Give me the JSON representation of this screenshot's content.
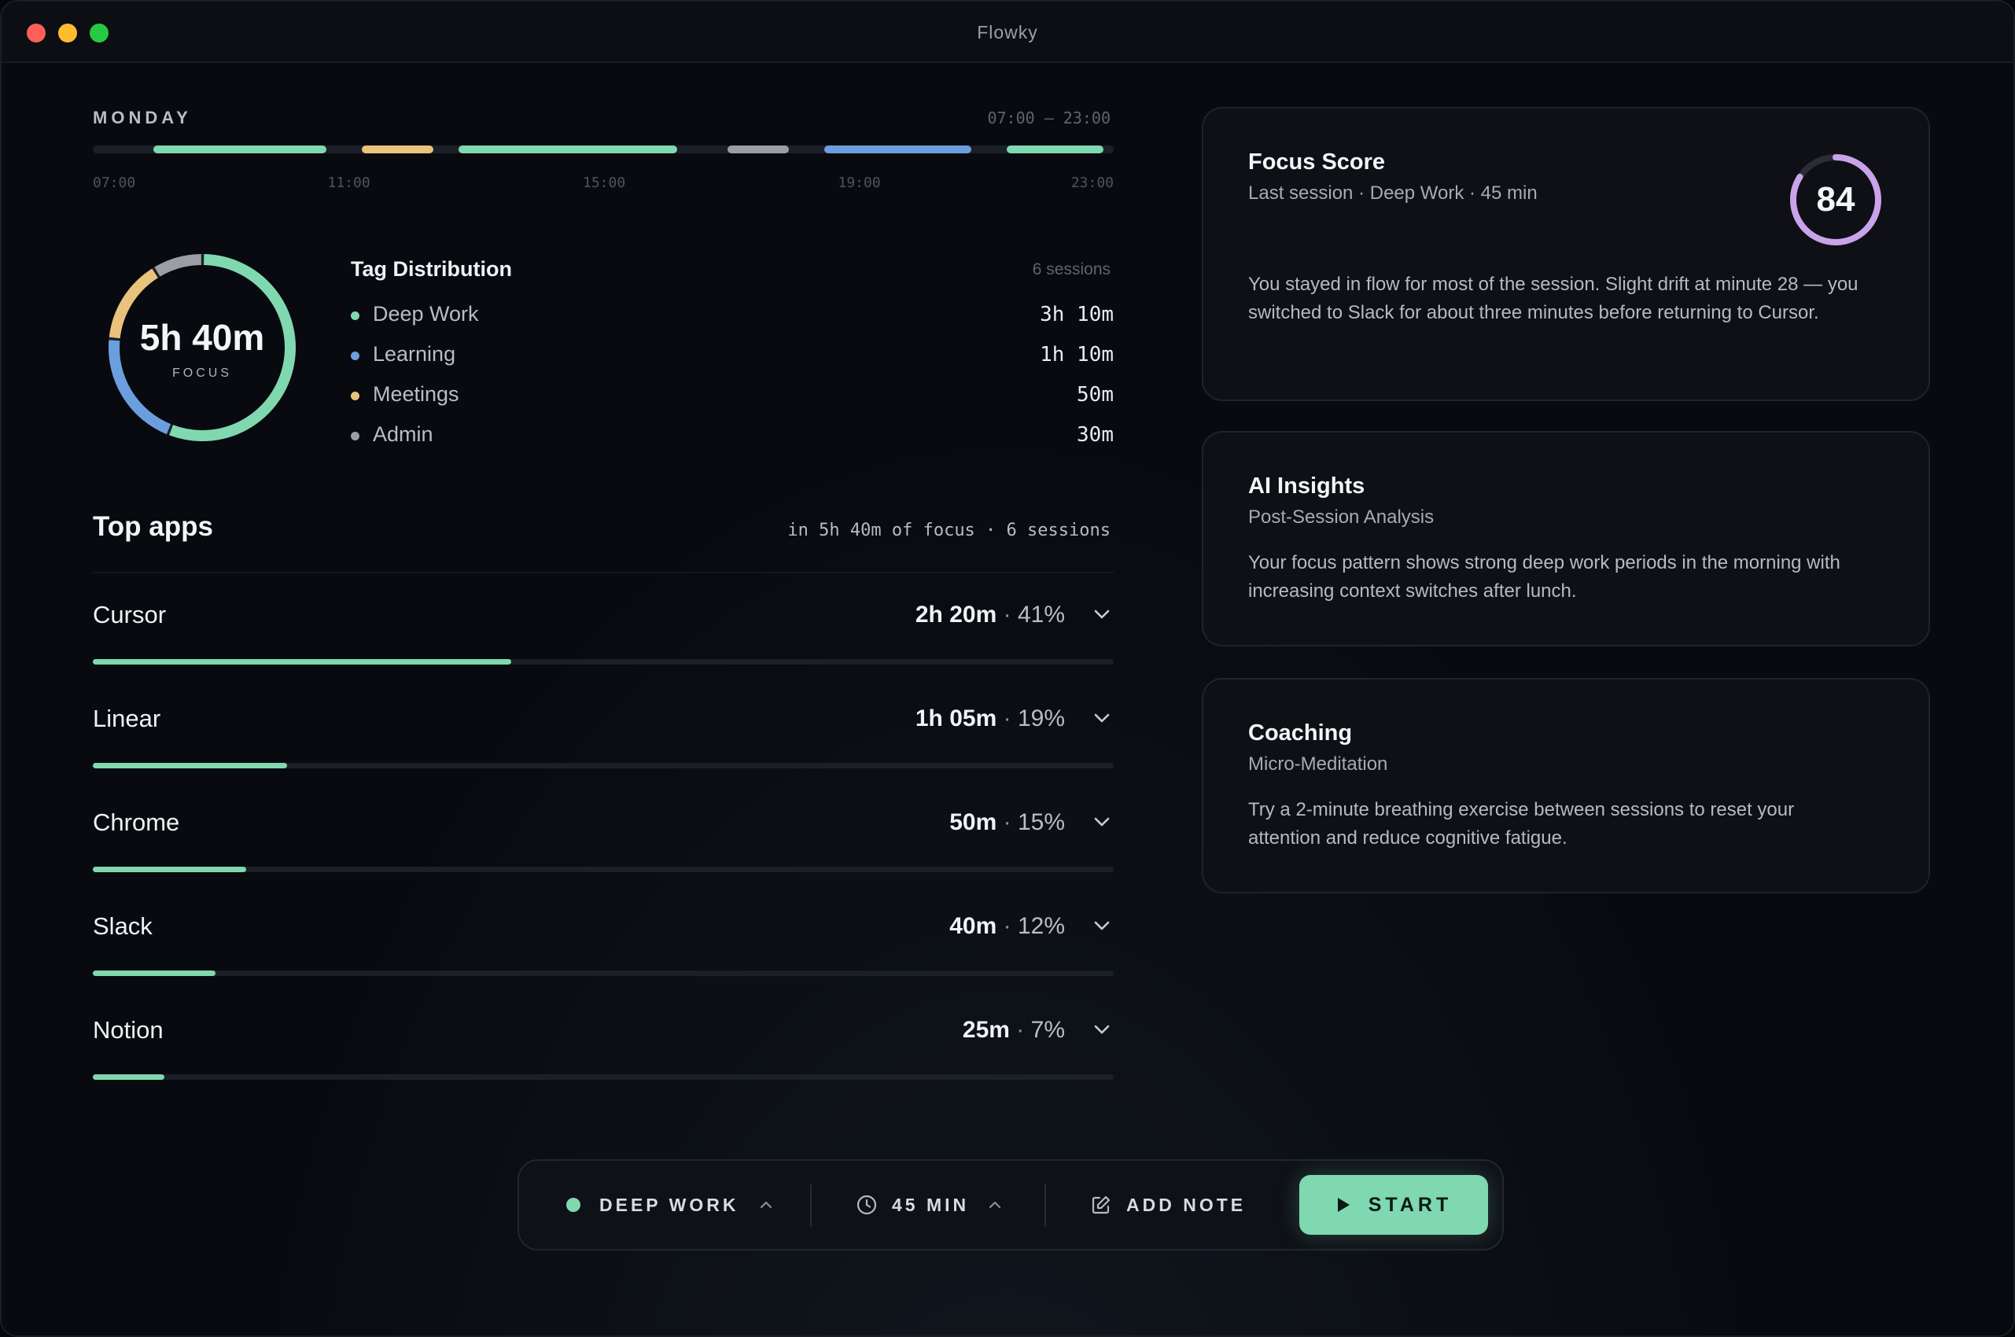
{
  "window": {
    "title": "Flowky"
  },
  "timeline": {
    "day": "MONDAY",
    "range": "07:00 — 23:00",
    "ticks": [
      "07:00",
      "11:00",
      "15:00",
      "19:00",
      "23:00"
    ],
    "segments": [
      {
        "start": "08:00",
        "end": "10:50",
        "color": "#7fd8b0"
      },
      {
        "start": "11:25",
        "end": "12:35",
        "color": "#e9c27c"
      },
      {
        "start": "13:00",
        "end": "16:35",
        "color": "#7fd8b0"
      },
      {
        "start": "17:25",
        "end": "18:25",
        "color": "#9a9ea5"
      },
      {
        "start": "19:00",
        "end": "21:25",
        "color": "#6b9ede"
      },
      {
        "start": "22:00",
        "end": "23:35",
        "color": "#7fd8b0"
      }
    ]
  },
  "focus_total": {
    "value": "5h 40m",
    "label": "FOCUS"
  },
  "tags": {
    "title": "Tag Distribution",
    "sessions": "6 sessions",
    "items": [
      {
        "name": "Deep Work",
        "value": "3h 10m",
        "minutes": 190,
        "color": "#7fd8b0"
      },
      {
        "name": "Learning",
        "value": "1h 10m",
        "minutes": 70,
        "color": "#6b9ede"
      },
      {
        "name": "Meetings",
        "value": "50m",
        "minutes": 50,
        "color": "#e9c27c"
      },
      {
        "name": "Admin",
        "value": "30m",
        "minutes": 30,
        "color": "#9a9ea5"
      }
    ]
  },
  "top_apps": {
    "title": "Top apps",
    "subtitle": "in 5h 40m of focus · 6 sessions",
    "sep": "·",
    "items": [
      {
        "name": "Cursor",
        "time": "2h 20m",
        "pct": "41%",
        "fraction": 0.41
      },
      {
        "name": "Linear",
        "time": "1h 05m",
        "pct": "19%",
        "fraction": 0.19
      },
      {
        "name": "Chrome",
        "time": "50m",
        "pct": "15%",
        "fraction": 0.15
      },
      {
        "name": "Slack",
        "time": "40m",
        "pct": "12%",
        "fraction": 0.12
      },
      {
        "name": "Notion",
        "time": "25m",
        "pct": "7%",
        "fraction": 0.07
      }
    ]
  },
  "cards": {
    "focus_score": {
      "title": "Focus Score",
      "subtitle": "Last session · Deep Work · 45 min",
      "score": "84",
      "score_fraction": 0.84,
      "body": "You stayed in flow for most of the session. Slight drift at minute 28 — you switched to Slack for about three minutes before returning to Cursor."
    },
    "ai_insights": {
      "title": "AI Insights",
      "subtitle": "Post-Session Analysis",
      "body": "Your focus pattern shows strong deep work periods in the morning with increasing context switches after lunch."
    },
    "coaching": {
      "title": "Coaching",
      "subtitle": "Micro-Meditation",
      "body": "Try a 2-minute breathing exercise between sessions to reset your attention and reduce cognitive fatigue."
    }
  },
  "bottom_bar": {
    "mode": "DEEP WORK",
    "duration": "45 MIN",
    "note": "ADD NOTE",
    "start": "START"
  },
  "colors": {
    "accent": "#7fd8b0",
    "blue": "#6b9ede",
    "yellow": "#e9c27c",
    "gray": "#9a9ea5",
    "score_ring": "#c9a3ea"
  },
  "icons": {
    "mode_dot": "status-dot-icon",
    "mode_chevron": "chevron-up-icon",
    "duration": "clock-icon",
    "note": "edit-note-icon",
    "start": "play-icon",
    "app_expand": "chevron-down-icon"
  }
}
